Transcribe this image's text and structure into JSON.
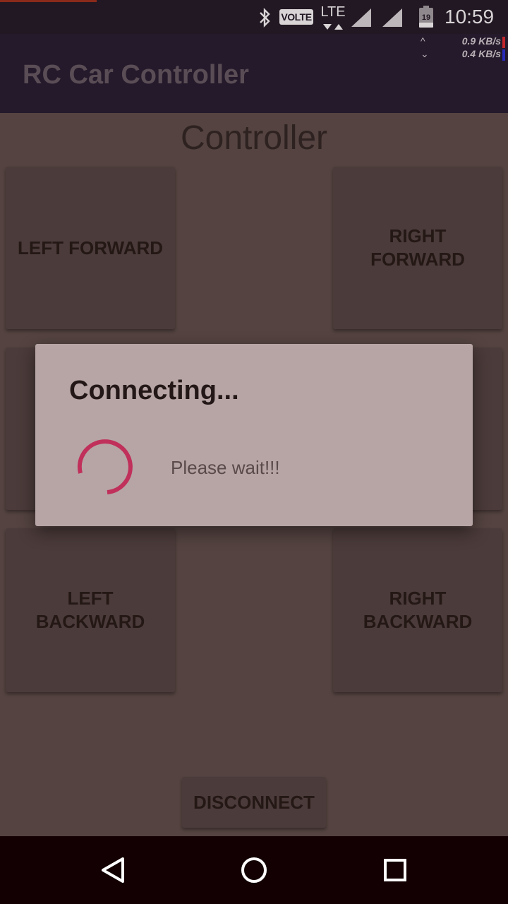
{
  "status_bar": {
    "time": "10:59",
    "volte": "VOLTE",
    "network": "LTE",
    "battery_level": "19",
    "icons": [
      "bluetooth-icon",
      "signal-icon",
      "signal-icon",
      "battery-icon"
    ]
  },
  "net_speed": {
    "up": "0.9 KB/s",
    "down": "0.4 KB/s",
    "up_arrow": "^",
    "down_arrow": "⌄",
    "colors": {
      "up": "#c0262b",
      "down": "#2a2ab8"
    }
  },
  "app_bar": {
    "title": "RC Car Controller"
  },
  "content": {
    "title": "Controller",
    "buttons": {
      "left_forward": "LEFT FORWARD",
      "right_forward": "RIGHT\nFORWARD",
      "left_backward": "LEFT\nBACKWARD",
      "right_backward": "RIGHT\nBACKWARD",
      "disconnect": "DISCONNECT"
    }
  },
  "dialog": {
    "title": "Connecting...",
    "message": "Please wait!!!",
    "spinner_color": "#c0305a"
  },
  "nav_bar": {
    "icons": [
      "back-icon",
      "home-icon",
      "recent-apps-icon"
    ]
  }
}
